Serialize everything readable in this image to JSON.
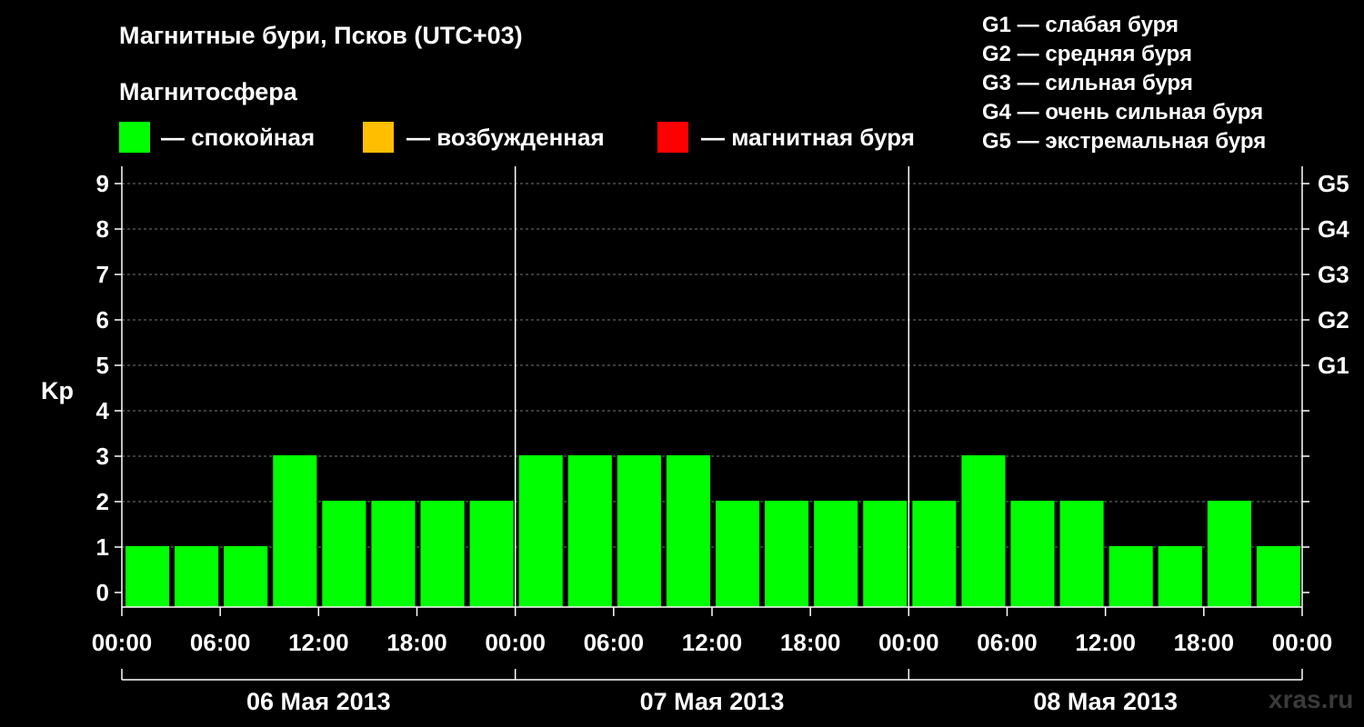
{
  "header": {
    "title": "Магнитные бури, Псков (UTC+03)",
    "legend_title": "Магнитосфера"
  },
  "legend": {
    "items": [
      {
        "label": "— спокойная",
        "color": "#00ff00"
      },
      {
        "label": "— возбужденная",
        "color": "#ffbf00"
      },
      {
        "label": "— магнитная буря",
        "color": "#ff0000"
      }
    ],
    "g_scale": [
      "G1 — слабая буря",
      "G2 — средняя буря",
      "G3 — сильная буря",
      "G4 — очень сильная буря",
      "G5 — экстремальная буря"
    ]
  },
  "watermark": "xras.ru",
  "chart_data": {
    "type": "bar",
    "ylabel": "Kp",
    "ylim": [
      0,
      9
    ],
    "y_ticks": [
      "0",
      "1",
      "2",
      "3",
      "4",
      "5",
      "6",
      "7",
      "8",
      "9"
    ],
    "right_ticks": [
      {
        "kp": 5,
        "label": "G1"
      },
      {
        "kp": 6,
        "label": "G2"
      },
      {
        "kp": 7,
        "label": "G3"
      },
      {
        "kp": 8,
        "label": "G4"
      },
      {
        "kp": 9,
        "label": "G5"
      }
    ],
    "x_tick_labels": [
      "00:00",
      "06:00",
      "12:00",
      "18:00",
      "00:00",
      "06:00",
      "12:00",
      "18:00",
      "00:00",
      "06:00",
      "12:00",
      "18:00",
      "00:00"
    ],
    "days": [
      "06 Мая 2013",
      "07 Мая 2013",
      "08 Мая 2013"
    ],
    "bar_interval_hours": 3,
    "values": [
      1,
      1,
      1,
      3,
      2,
      2,
      2,
      2,
      3,
      3,
      3,
      3,
      2,
      2,
      2,
      2,
      2,
      3,
      2,
      2,
      1,
      1,
      2,
      1
    ],
    "colors": {
      "quiet": "#00ff00",
      "active": "#ffbf00",
      "storm": "#ff0000"
    },
    "grid": true
  }
}
